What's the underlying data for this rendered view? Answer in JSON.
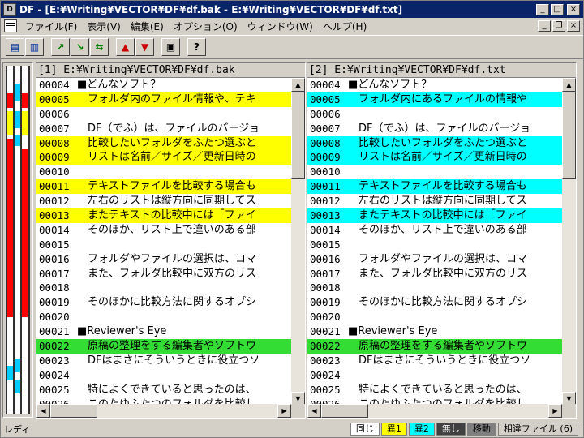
{
  "window": {
    "title": "DF - [E:¥Writing¥VECTOR¥DF¥df.bak  -  E:¥Writing¥VECTOR¥DF¥df.txt]"
  },
  "menu": [
    "ファイル(F)",
    "表示(V)",
    "編集(E)",
    "オプション(O)",
    "ウィンドウ(W)",
    "ヘルプ(H)"
  ],
  "toolbar": {
    "help_glyph": "?"
  },
  "left_pane": {
    "header": "[1] E:¥Writing¥VECTOR¥DF¥df.bak",
    "lines": [
      {
        "no": "00004",
        "text": "■どんなソフト？",
        "hl": ""
      },
      {
        "no": "00005",
        "text": "　フォルダ内のファイル情報や、テキ",
        "hl": "yellow"
      },
      {
        "no": "00006",
        "text": "",
        "hl": ""
      },
      {
        "no": "00007",
        "text": "　DF（でふ）は、ファイルのバージョ",
        "hl": ""
      },
      {
        "no": "00008",
        "text": "　比較したいフォルダをふたつ選ぶと",
        "hl": "yellow"
      },
      {
        "no": "00009",
        "text": "　リストは名前／サイズ／更新日時の",
        "hl": "yellow"
      },
      {
        "no": "00010",
        "text": "",
        "hl": ""
      },
      {
        "no": "00011",
        "text": "　テキストファイルを比較する場合も",
        "hl": "yellow"
      },
      {
        "no": "00012",
        "text": "　左右のリストは縦方向に同期してス",
        "hl": ""
      },
      {
        "no": "00013",
        "text": "　またテキストの比較中には「ファイ",
        "hl": "yellow"
      },
      {
        "no": "00014",
        "text": "　そのほか、リスト上で違いのある部",
        "hl": ""
      },
      {
        "no": "00015",
        "text": "",
        "hl": ""
      },
      {
        "no": "00016",
        "text": "　フォルダやファイルの選択は、コマ",
        "hl": ""
      },
      {
        "no": "00017",
        "text": "　また、フォルダ比較中に双方のリス",
        "hl": ""
      },
      {
        "no": "00018",
        "text": "",
        "hl": ""
      },
      {
        "no": "00019",
        "text": "　そのほかに比較方法に関するオプシ",
        "hl": ""
      },
      {
        "no": "00020",
        "text": "",
        "hl": ""
      },
      {
        "no": "00021",
        "text": "■Reviewer's Eye",
        "hl": ""
      },
      {
        "no": "00022",
        "text": "　原稿の整理をする編集者やソフトウ",
        "hl": "green"
      },
      {
        "no": "00023",
        "text": "　DFはまさにそういうときに役立つソ",
        "hl": ""
      },
      {
        "no": "00024",
        "text": "",
        "hl": ""
      },
      {
        "no": "00025",
        "text": "　特によくできていると思ったのは、",
        "hl": ""
      },
      {
        "no": "00026",
        "text": "　このたゆふたつのフォルダを比較し",
        "hl": ""
      }
    ]
  },
  "right_pane": {
    "header": "[2] E:¥Writing¥VECTOR¥DF¥df.txt",
    "lines": [
      {
        "no": "00004",
        "text": "■どんなソフト？",
        "hl": ""
      },
      {
        "no": "00005",
        "text": "　フォルダ内にあるファイルの情報や",
        "hl": "cyan"
      },
      {
        "no": "00006",
        "text": "",
        "hl": ""
      },
      {
        "no": "00007",
        "text": "　DF（でふ）は、ファイルのバージョ",
        "hl": ""
      },
      {
        "no": "00008",
        "text": "　比較したいフォルダをふたつ選ぶと",
        "hl": "cyan"
      },
      {
        "no": "00009",
        "text": "　リストは名前／サイズ／更新日時の",
        "hl": "cyan"
      },
      {
        "no": "00010",
        "text": "",
        "hl": ""
      },
      {
        "no": "00011",
        "text": "　テキストファイルを比較する場合も",
        "hl": "cyan"
      },
      {
        "no": "00012",
        "text": "　左右のリストは縦方向に同期してス",
        "hl": ""
      },
      {
        "no": "00013",
        "text": "　またテキストの比較中には「ファイ",
        "hl": "cyan"
      },
      {
        "no": "00014",
        "text": "　そのほか、リスト上で違いのある部",
        "hl": ""
      },
      {
        "no": "00015",
        "text": "",
        "hl": ""
      },
      {
        "no": "00016",
        "text": "　フォルダやファイルの選択は、コマ",
        "hl": ""
      },
      {
        "no": "00017",
        "text": "　また、フォルダ比較中に双方のリス",
        "hl": ""
      },
      {
        "no": "00018",
        "text": "",
        "hl": ""
      },
      {
        "no": "00019",
        "text": "　そのほかに比較方法に関するオプシ",
        "hl": ""
      },
      {
        "no": "00020",
        "text": "",
        "hl": ""
      },
      {
        "no": "00021",
        "text": "■Reviewer's Eye",
        "hl": ""
      },
      {
        "no": "00022",
        "text": "　原稿の整理をする編集者やソフトウ",
        "hl": "green"
      },
      {
        "no": "00023",
        "text": "　DFはまさにそういうときに役立つソ",
        "hl": ""
      },
      {
        "no": "00024",
        "text": "",
        "hl": ""
      },
      {
        "no": "00025",
        "text": "　特によくできていると思ったのは、",
        "hl": ""
      },
      {
        "no": "00026",
        "text": "　このたゆふたつのフォルダを比較し",
        "hl": ""
      }
    ]
  },
  "overview_marks": [
    {
      "col": 0,
      "from": 0.08,
      "to": 0.12,
      "color": "#ff0000"
    },
    {
      "col": 0,
      "from": 0.13,
      "to": 0.2,
      "color": "#ffff00"
    },
    {
      "col": 0,
      "from": 0.21,
      "to": 0.24,
      "color": "#ff0000"
    },
    {
      "col": 0,
      "from": 0.24,
      "to": 0.72,
      "color": "#ff0000"
    },
    {
      "col": 0,
      "from": 0.86,
      "to": 0.9,
      "color": "#00ccff"
    },
    {
      "col": 1,
      "from": 0.05,
      "to": 0.1,
      "color": "#00ccff"
    },
    {
      "col": 1,
      "from": 0.13,
      "to": 0.18,
      "color": "#00ccff"
    },
    {
      "col": 1,
      "from": 0.2,
      "to": 0.23,
      "color": "#00ccff"
    },
    {
      "col": 1,
      "from": 0.84,
      "to": 0.88,
      "color": "#00ccff"
    },
    {
      "col": 1,
      "from": 0.9,
      "to": 0.94,
      "color": "#00ccff"
    },
    {
      "col": 2,
      "from": 0.08,
      "to": 0.12,
      "color": "#ff0000"
    },
    {
      "col": 2,
      "from": 0.13,
      "to": 0.2,
      "color": "#ffff00"
    },
    {
      "col": 2,
      "from": 0.24,
      "to": 0.72,
      "color": "#ff0000"
    }
  ],
  "status": {
    "text": "レディ",
    "legend": [
      {
        "label": "同じ",
        "bg": "#ffffff",
        "fg": "#000000"
      },
      {
        "label": "異1",
        "bg": "#ffff00",
        "fg": "#000000"
      },
      {
        "label": "異2",
        "bg": "#00ffff",
        "fg": "#000000"
      },
      {
        "label": "無し",
        "bg": "#404040",
        "fg": "#ffffff"
      },
      {
        "label": "移動",
        "bg": "#808080",
        "fg": "#000000"
      },
      {
        "label": "相違ファイル (6)",
        "bg": "#d4d0c8",
        "fg": "#000000"
      }
    ]
  },
  "colors": {
    "yellow": "#ffff00",
    "cyan": "#00ffff",
    "green": "#33dd33"
  }
}
